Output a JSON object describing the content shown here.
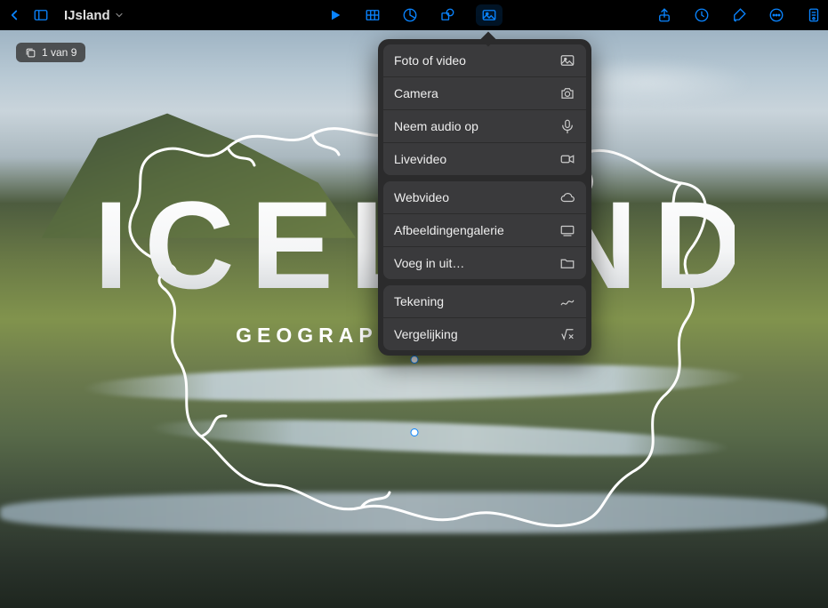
{
  "toolbar": {
    "doc_title": "IJsland"
  },
  "slide_counter": {
    "text": "1 van 9"
  },
  "slide": {
    "title": "ICELAND",
    "subtitle": "GEOGRAPHY FIELD TRIP"
  },
  "popover": {
    "sections": [
      {
        "items": [
          {
            "label": "Foto of video",
            "icon": "photo-icon"
          },
          {
            "label": "Camera",
            "icon": "camera-icon"
          },
          {
            "label": "Neem audio op",
            "icon": "microphone-icon"
          },
          {
            "label": "Livevideo",
            "icon": "video-camera-icon"
          }
        ]
      },
      {
        "items": [
          {
            "label": "Webvideo",
            "icon": "cloud-icon"
          },
          {
            "label": "Afbeeldingengalerie",
            "icon": "gallery-icon"
          },
          {
            "label": "Voeg in uit…",
            "icon": "folder-icon"
          }
        ]
      },
      {
        "items": [
          {
            "label": "Tekening",
            "icon": "scribble-icon"
          },
          {
            "label": "Vergelijking",
            "icon": "equation-icon"
          }
        ]
      }
    ]
  }
}
